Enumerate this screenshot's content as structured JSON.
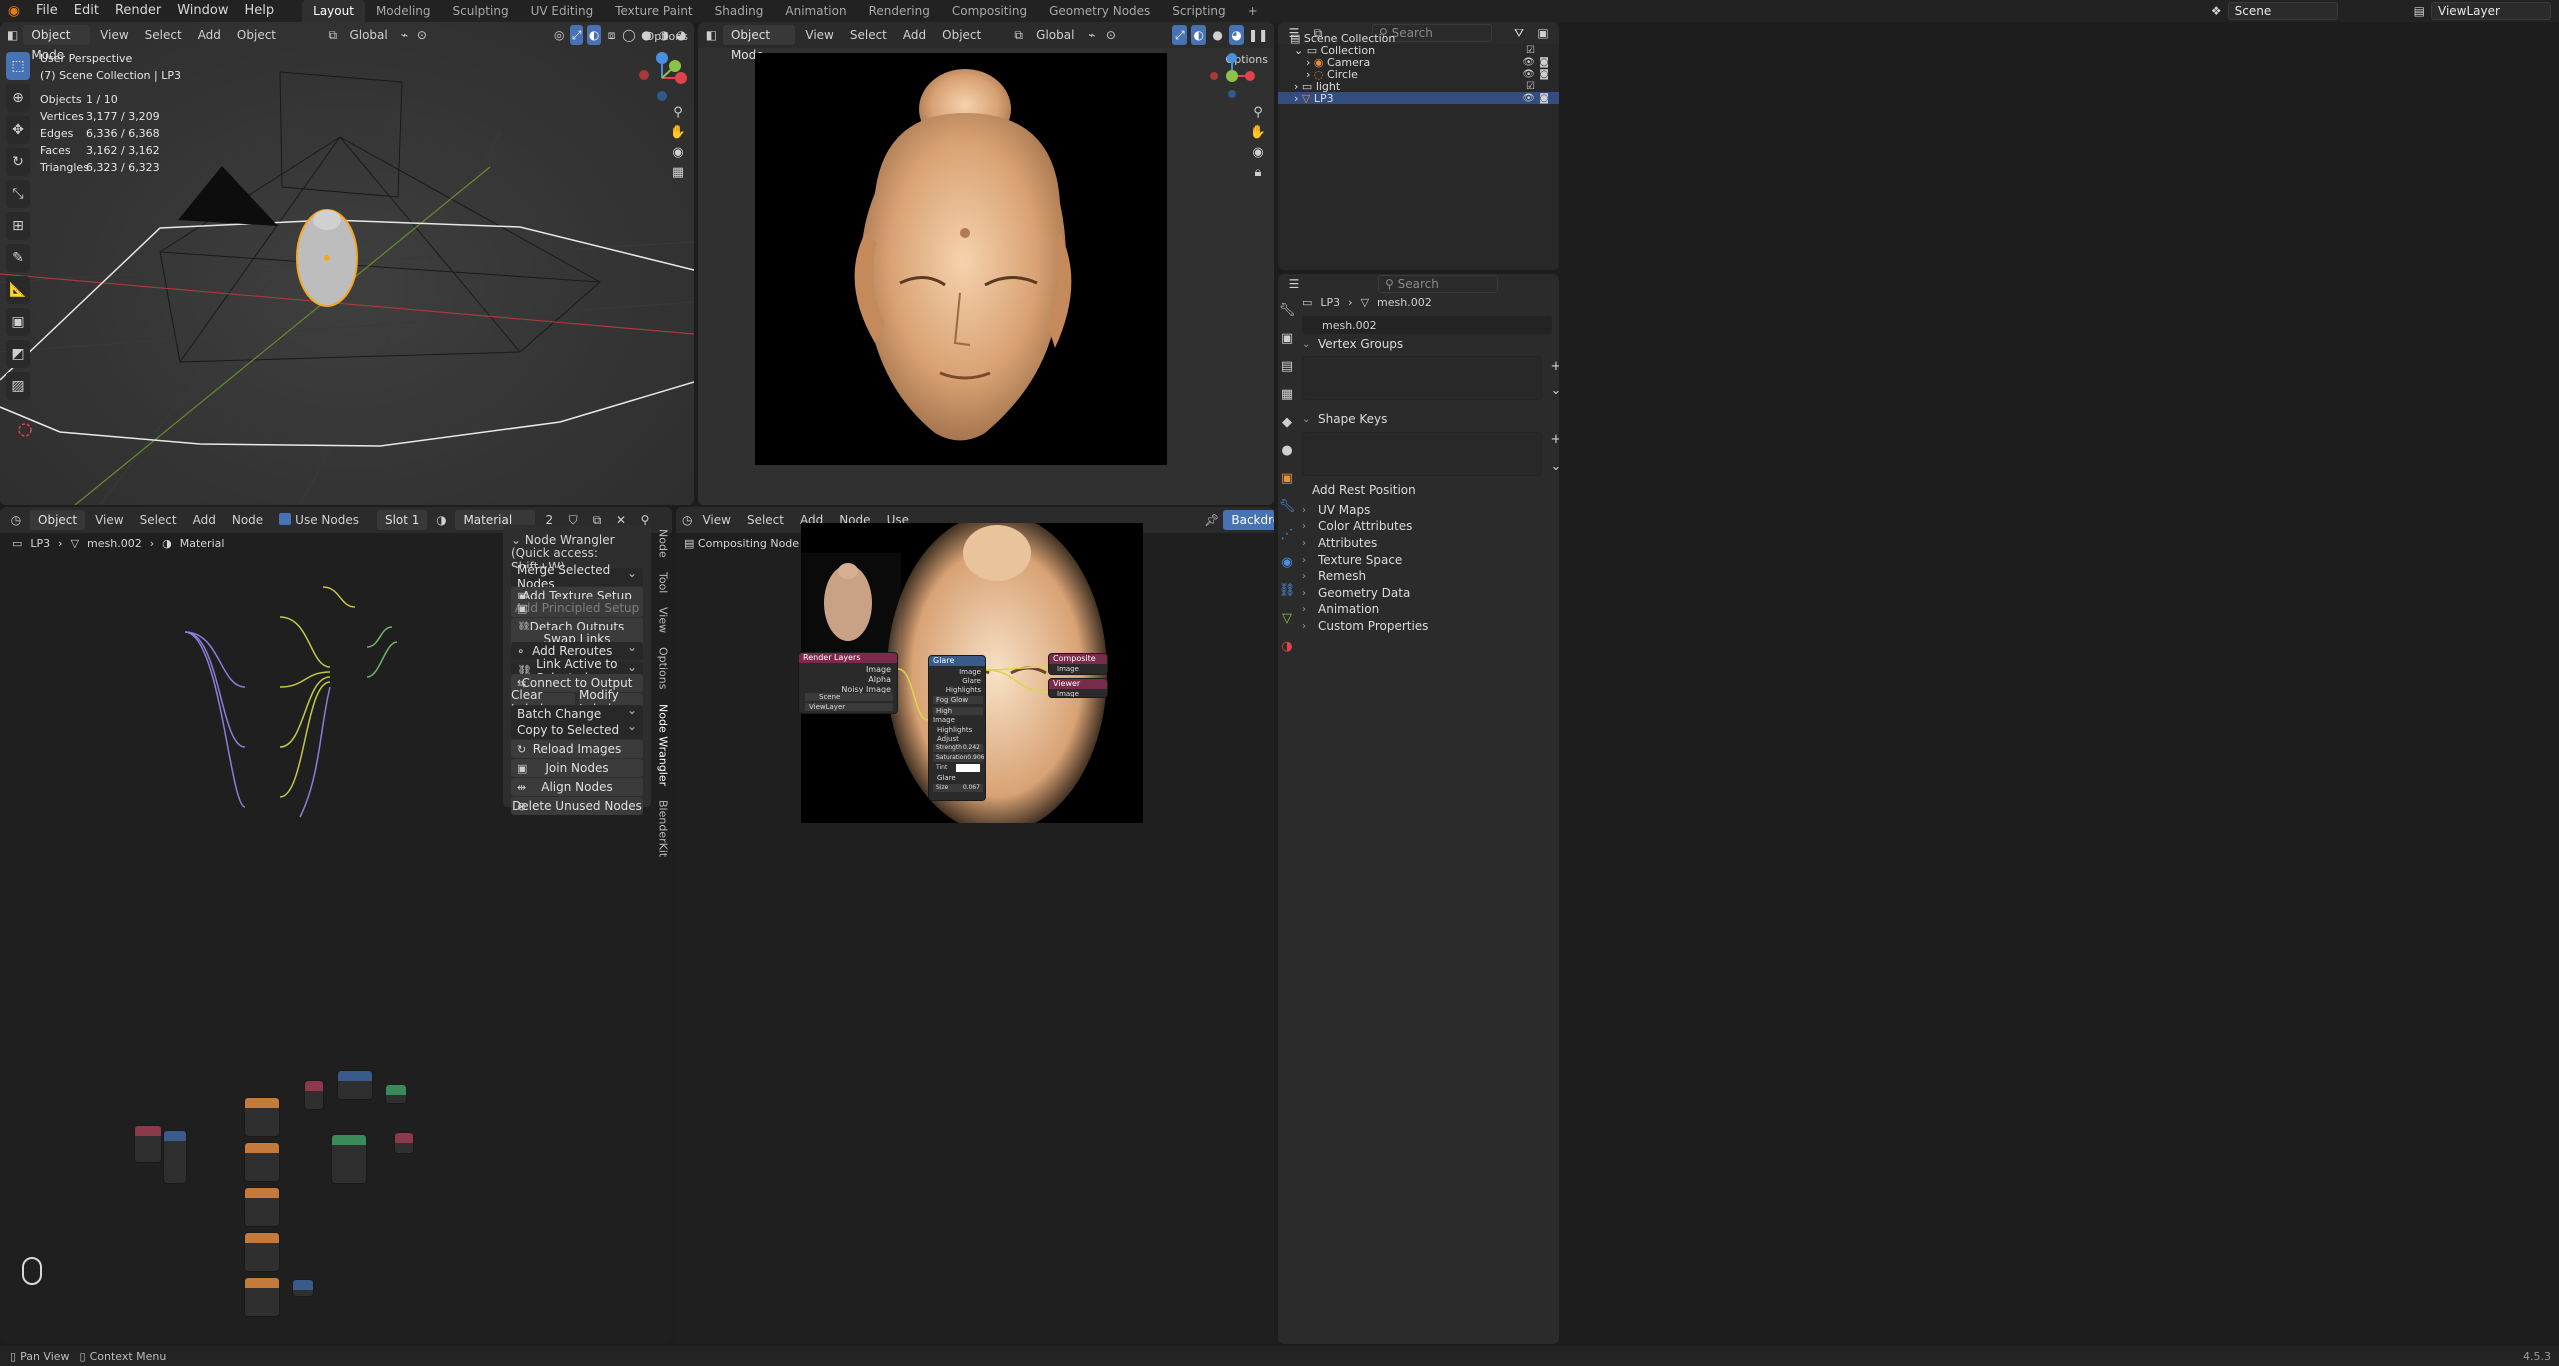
{
  "topbar": {
    "menus": [
      "File",
      "Edit",
      "Render",
      "Window",
      "Help"
    ],
    "workspace_tabs": [
      "Layout",
      "Modeling",
      "Sculpting",
      "UV Editing",
      "Texture Paint",
      "Shading",
      "Animation",
      "Rendering",
      "Compositing",
      "Geometry Nodes",
      "Scripting"
    ],
    "active_workspace": "Layout",
    "add_tab": "+",
    "scene": "Scene",
    "view_layer": "ViewLayer"
  },
  "viewport": {
    "mode": "Object Mode",
    "menus": [
      "View",
      "Select",
      "Add",
      "Object"
    ],
    "orientation": "Global",
    "options": "Options",
    "title": "User Perspective",
    "subtitle": "(7) Scene Collection | LP3",
    "stats": [
      {
        "label": "Objects",
        "value": "1 / 10"
      },
      {
        "label": "Vertices",
        "value": "3,177 / 3,209"
      },
      {
        "label": "Edges",
        "value": "6,336 / 6,368"
      },
      {
        "label": "Faces",
        "value": "3,162 / 3,162"
      },
      {
        "label": "Triangles",
        "value": "6,323 / 6,323"
      }
    ],
    "gizmo_axes": [
      "X",
      "Y",
      "Z"
    ]
  },
  "render_view": {
    "mode": "Object Mode",
    "menus": [
      "View",
      "Select",
      "Add",
      "Object"
    ],
    "orientation": "Global",
    "options": "Options"
  },
  "shader_editor": {
    "type": "Object",
    "menus": [
      "View",
      "Select",
      "Add",
      "Node"
    ],
    "use_nodes": "Use Nodes",
    "slot": "Slot 1",
    "material": "Material",
    "users": "2",
    "breadcrumb": [
      "LP3",
      "mesh.002",
      "Material"
    ],
    "node_wrangler": {
      "title": "Node Wrangler",
      "quick_access": "(Quick access: Shift+W)",
      "merge": "Merge Selected Nodes",
      "add_texture": "Add Texture Setup",
      "add_principled": "Add Principled Setup",
      "detach": "Detach Outputs",
      "swap": "Swap Links",
      "add_reroutes": "Add Reroutes",
      "link_active": "Link Active to Selected",
      "connect_output": "Connect to Output",
      "clear_label": "Clear Label",
      "modify_labels": "Modify Labels",
      "batch_change": "Batch Change",
      "copy_selected": "Copy to Selected",
      "reload_images": "Reload Images",
      "join_nodes": "Join Nodes",
      "align_nodes": "Align Nodes",
      "delete_unused": "Delete Unused Nodes"
    },
    "side_tabs": [
      "Node",
      "Tool",
      "View",
      "Options",
      "Node Wrangler",
      "BlenderKit"
    ]
  },
  "compositor": {
    "menus": [
      "View",
      "Select",
      "Add",
      "Node"
    ],
    "use_nodes": "Use Nodes",
    "backdrop": "Backdrop",
    "tree_title": "Compositing Node Tree",
    "nodes": {
      "render_layers": {
        "title": "Render Layers",
        "outputs": [
          "Image",
          "Alpha",
          "Noisy Image"
        ],
        "scene": "Scene",
        "layer": "ViewLayer"
      },
      "glare": {
        "title": "Glare",
        "outputs": [
          "Image",
          "Glare",
          "Highlights"
        ],
        "type": "Fog Glow",
        "quality": "High",
        "input": "Image",
        "highlights": "Highlights",
        "adjust": "Adjust",
        "strength_label": "Strength",
        "strength": "0.242",
        "saturation_label": "Saturation",
        "saturation": "0.906",
        "tint": "Tint",
        "glare_section": "Glare",
        "size_label": "Size",
        "size": "0.067"
      },
      "composite": {
        "title": "Composite",
        "input": "Image"
      },
      "viewer": {
        "title": "Viewer",
        "input": "Image"
      }
    }
  },
  "outliner": {
    "search_placeholder": "Search",
    "items": [
      {
        "name": "Scene Collection",
        "depth": 0
      },
      {
        "name": "Collection",
        "depth": 1
      },
      {
        "name": "Camera",
        "depth": 2
      },
      {
        "name": "Circle",
        "depth": 2
      },
      {
        "name": "light",
        "depth": 1
      },
      {
        "name": "LP3",
        "depth": 1
      }
    ],
    "selected": "LP3"
  },
  "properties": {
    "search_placeholder": "Search",
    "breadcrumb": [
      "LP3",
      "mesh.002"
    ],
    "data_name": "mesh.002",
    "vertex_groups": "Vertex Groups",
    "shape_keys": "Shape Keys",
    "add_rest_position": "Add Rest Position",
    "panels": [
      "UV Maps",
      "Color Attributes",
      "Attributes",
      "Texture Space",
      "Remesh",
      "Geometry Data",
      "Animation",
      "Custom Properties"
    ]
  },
  "statusbar": {
    "pan_view": "Pan View",
    "context_menu": "Context Menu",
    "version": "4.5.3"
  },
  "colors": {
    "accent": "#4772b3",
    "selection": "#334d80",
    "object_outline": "#f5a623",
    "x_axis": "#e0434d",
    "y_axis": "#8bc34a",
    "z_axis": "#4a90e2",
    "sculpture": "#e6b88a"
  }
}
